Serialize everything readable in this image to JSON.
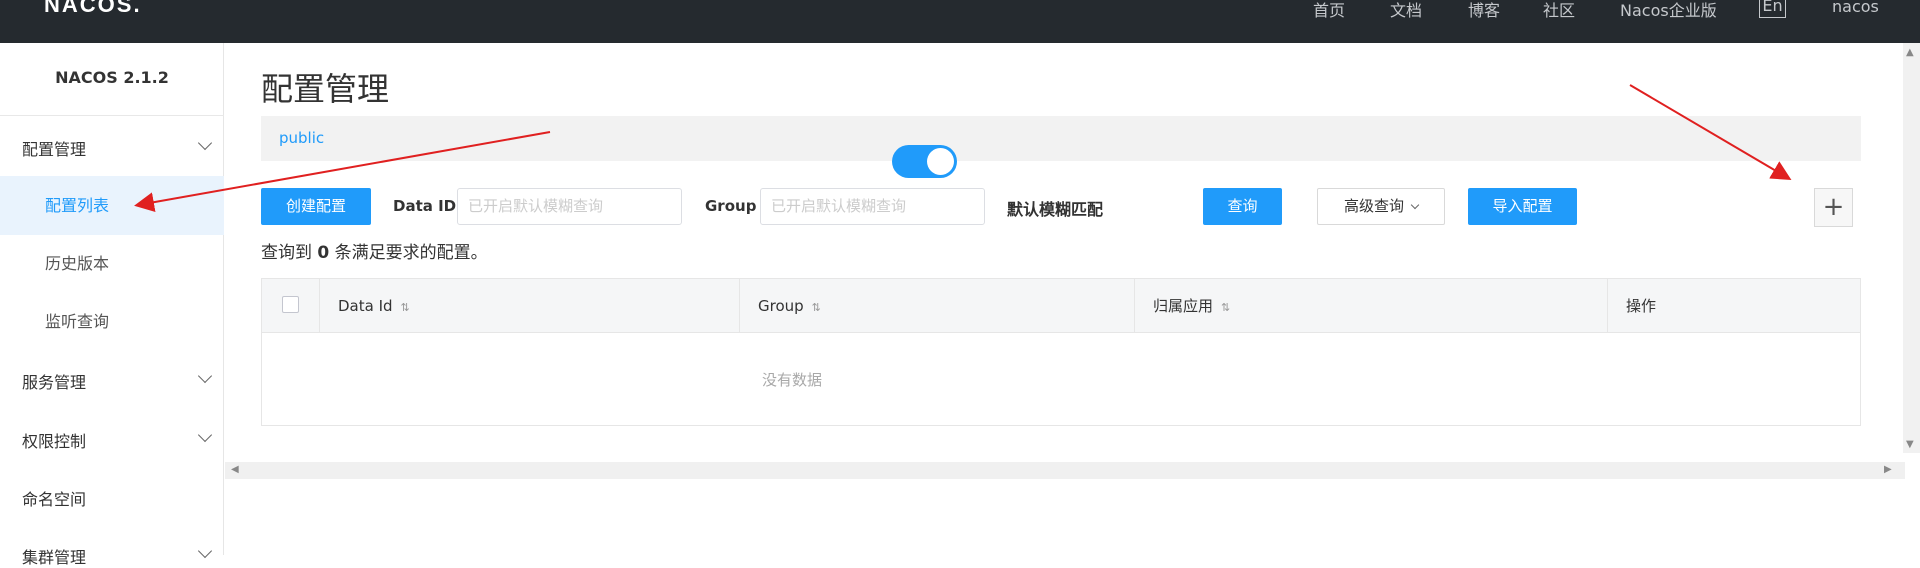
{
  "header": {
    "logo": "NACOS.",
    "nav": [
      "首页",
      "文档",
      "博客",
      "社区",
      "Nacos企业版"
    ],
    "lang": "En",
    "user": "nacos"
  },
  "sidebar": {
    "version": "NACOS 2.1.2",
    "groups": [
      {
        "label": "配置管理",
        "items": [
          "配置列表",
          "历史版本",
          "监听查询"
        ]
      },
      {
        "label": "服务管理"
      },
      {
        "label": "权限控制"
      },
      {
        "label": "命名空间"
      },
      {
        "label": "集群管理"
      }
    ]
  },
  "main": {
    "title": "配置管理",
    "namespace": "public",
    "toolbar": {
      "create_button": "创建配置",
      "data_id_label": "Data ID",
      "data_id_placeholder": "已开启默认模糊查询",
      "group_label": "Group",
      "group_placeholder": "已开启默认模糊查询",
      "fuzzy_label": "默认模糊匹配",
      "fuzzy_on": true,
      "query_button": "查询",
      "advanced_query": "高级查询",
      "import_button": "导入配置",
      "add_icon": "plus-icon"
    },
    "result": {
      "prefix": "查询到",
      "count": "0",
      "suffix": "条满足要求的配置。"
    },
    "table": {
      "columns": [
        "Data Id",
        "Group",
        "归属应用",
        "操作"
      ],
      "empty": "没有数据"
    }
  },
  "colors": {
    "accent": "#209bfa",
    "header_bg": "#252a2f",
    "arrow": "#e02020"
  }
}
